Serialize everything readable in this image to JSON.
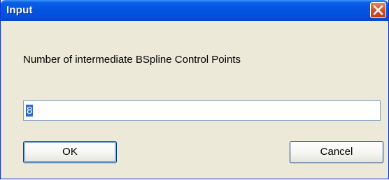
{
  "window": {
    "title": "Input",
    "close_icon": "close-x-icon",
    "colors": {
      "titlebar": "#0453e0",
      "close_button": "#d4552e",
      "dialog_background": "#ece9d8",
      "selection": "#316ac5"
    }
  },
  "dialog": {
    "prompt": "Number of intermediate BSpline Control Points",
    "input_value": "8",
    "ok_label": "OK",
    "cancel_label": "Cancel"
  }
}
